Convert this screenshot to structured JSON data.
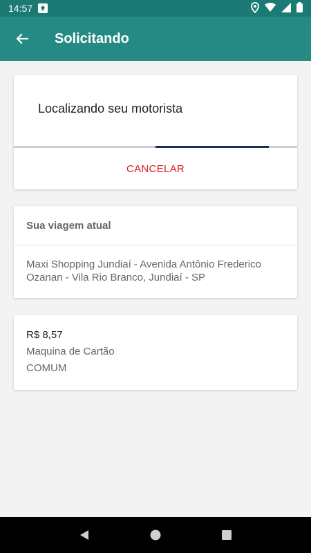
{
  "status_bar": {
    "time": "14:57",
    "icons": [
      "notification-icon",
      "location-icon",
      "wifi-icon",
      "signal-icon",
      "battery-icon"
    ]
  },
  "app_bar": {
    "title": "Solicitando",
    "back_icon": "arrow-back-icon",
    "color": "#268a84"
  },
  "searching_card": {
    "message": "Localizando seu motorista",
    "progress_fraction": [
      0.5,
      0.9
    ],
    "cancel_label": "CANCELAR",
    "cancel_color": "#e01b1b"
  },
  "trip_card": {
    "heading": "Sua viagem atual",
    "address": "Maxi Shopping Jundiaí - Avenida Antônio Frederico Ozanan - Vila Rio Branco, Jundiaí - SP"
  },
  "payment_card": {
    "price": "R$ 8,57",
    "method": "Maquina de Cartão",
    "category": "COMUM"
  },
  "nav_bar": {
    "icons": [
      "back-triangle-icon",
      "home-circle-icon",
      "recents-square-icon"
    ]
  }
}
